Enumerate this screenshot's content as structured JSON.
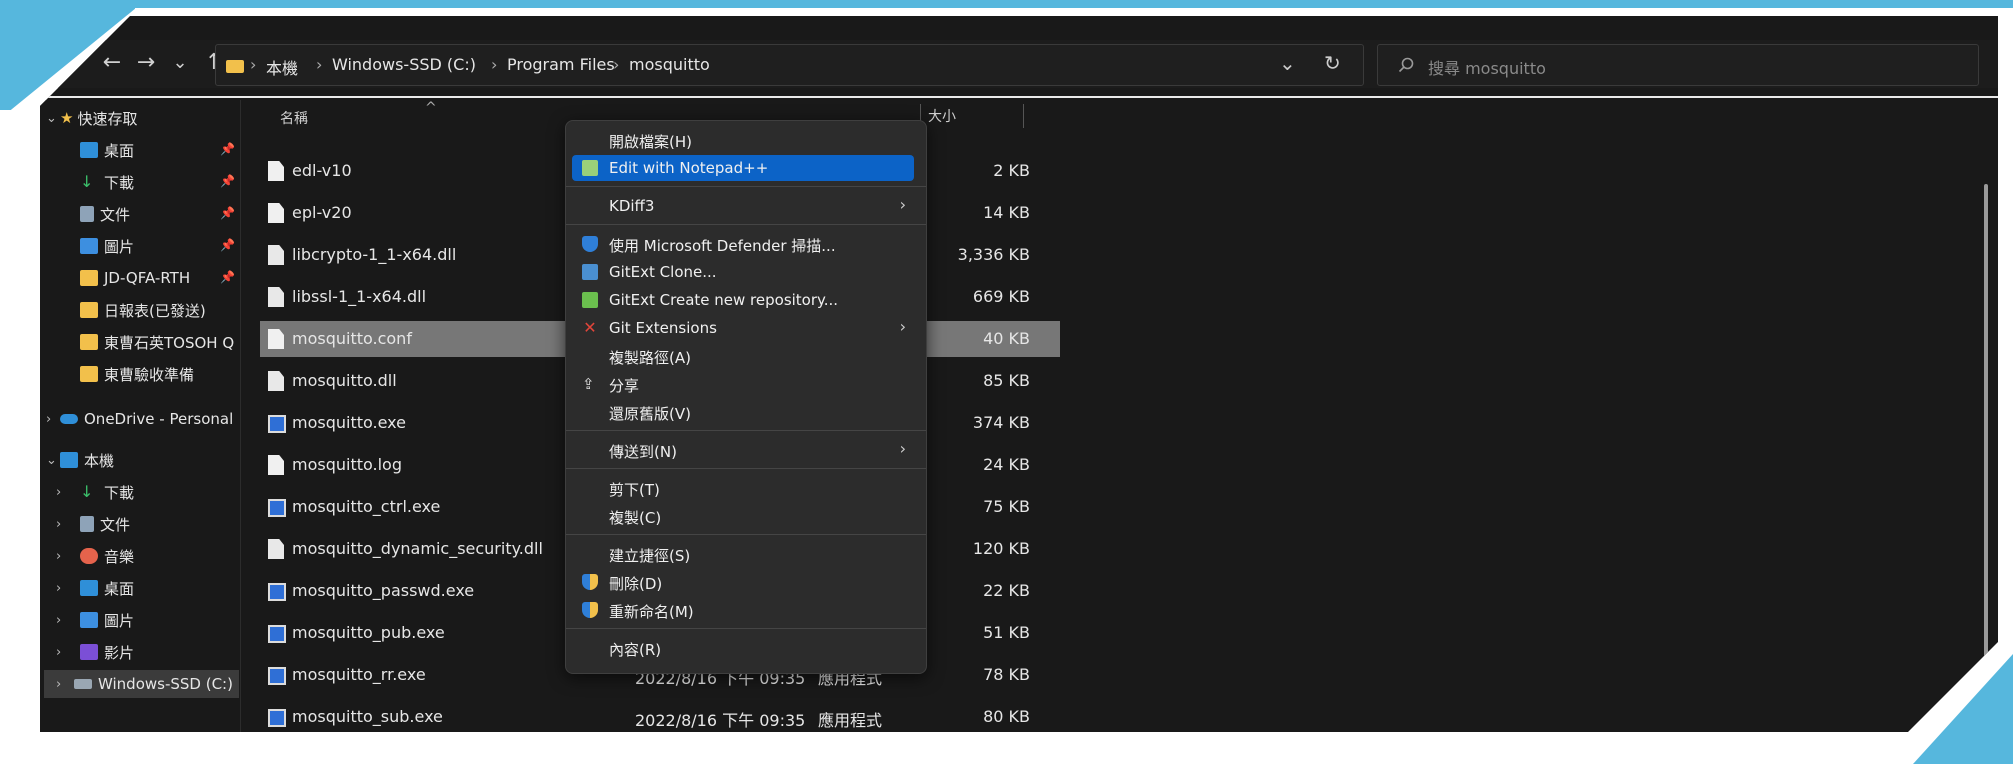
{
  "address": {
    "segments": [
      "本機",
      "Windows-SSD (C:)",
      "Program Files",
      "mosquitto"
    ]
  },
  "search": {
    "placeholder": "搜尋 mosquitto"
  },
  "nav": {
    "back": "←",
    "forward": "→",
    "recent": "⌄",
    "up": "↑",
    "dropdown": "⌄",
    "refresh": "↻"
  },
  "columns": {
    "name": "名稱",
    "size": "大小"
  },
  "sidebar": {
    "quick_access": "快速存取",
    "items": [
      "桌面",
      "下載",
      "文件",
      "圖片",
      "JD-QFA-RTH",
      "日報表(已發送)",
      "東曹石英TOSOH Q",
      "東曹驗收準備"
    ],
    "onedrive": "OneDrive - Personal",
    "this_pc": "本機",
    "pc_items": [
      "下載",
      "文件",
      "音樂",
      "桌面",
      "圖片",
      "影片",
      "Windows-SSD (C:)"
    ]
  },
  "files": [
    {
      "name": "edl-v10",
      "size": "2 KB",
      "icon": "doc"
    },
    {
      "name": "epl-v20",
      "size": "14 KB",
      "icon": "doc"
    },
    {
      "name": "libcrypto-1_1-x64.dll",
      "size": "3,336 KB",
      "icon": "dll"
    },
    {
      "name": "libssl-1_1-x64.dll",
      "size": "669 KB",
      "icon": "dll"
    },
    {
      "name": "mosquitto.conf",
      "size": "40 KB",
      "icon": "doc"
    },
    {
      "name": "mosquitto.dll",
      "size": "85 KB",
      "icon": "dll"
    },
    {
      "name": "mosquitto.exe",
      "size": "374 KB",
      "icon": "exe"
    },
    {
      "name": "mosquitto.log",
      "size": "24 KB",
      "icon": "doc"
    },
    {
      "name": "mosquitto_ctrl.exe",
      "size": "75 KB",
      "icon": "exe"
    },
    {
      "name": "mosquitto_dynamic_security.dll",
      "size": "120 KB",
      "icon": "dll"
    },
    {
      "name": "mosquitto_passwd.exe",
      "size": "22 KB",
      "icon": "exe"
    },
    {
      "name": "mosquitto_pub.exe",
      "size": "51 KB",
      "icon": "exe"
    },
    {
      "name": "mosquitto_rr.exe",
      "size": "78 KB",
      "icon": "exe",
      "date": "2022/8/16 下午 09:35",
      "type": "應用程式"
    },
    {
      "name": "mosquitto_sub.exe",
      "size": "80 KB",
      "icon": "exe",
      "date": "2022/8/16 下午 09:35",
      "type": "應用程式"
    }
  ],
  "context_menu": {
    "items": [
      "開啟檔案(H)",
      "Edit with Notepad++",
      "KDiff3",
      "使用 Microsoft Defender 掃描...",
      "GitExt Clone...",
      "GitExt Create new repository...",
      "Git Extensions",
      "複製路徑(A)",
      "分享",
      "還原舊版(V)",
      "傳送到(N)",
      "剪下(T)",
      "複製(C)",
      "建立捷徑(S)",
      "刪除(D)",
      "重新命名(M)",
      "內容(R)"
    ],
    "submenu_arrow": "›"
  }
}
